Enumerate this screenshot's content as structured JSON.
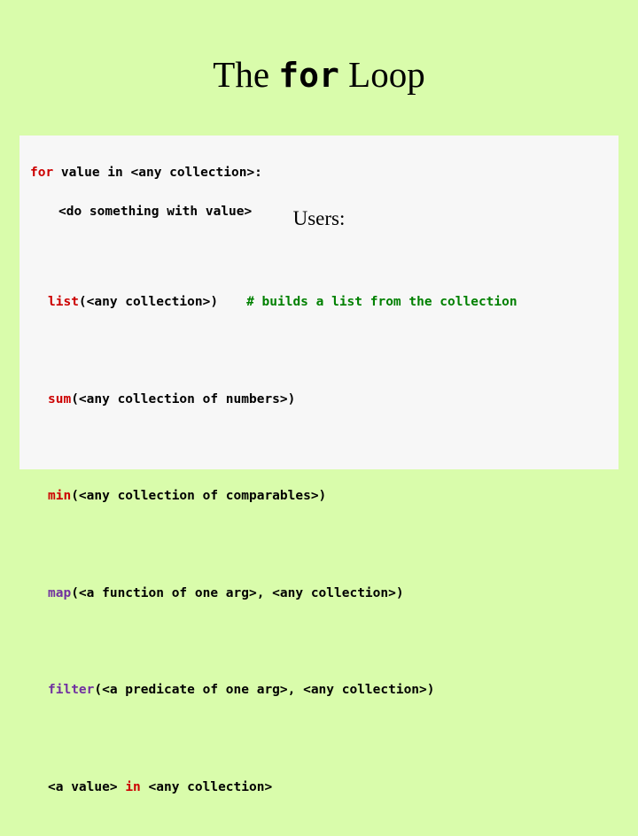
{
  "slide": {
    "background_color": "#d9fcab",
    "title": {
      "prefix": "The ",
      "keyword": "for",
      "suffix": " Loop"
    },
    "code_block": {
      "line1_kw": "for",
      "line1_rest": " value in <any collection>:",
      "line2": "<do something with value>"
    },
    "users_heading": "Users:",
    "examples": [
      {
        "func": "list",
        "args": "(<any collection>)",
        "comment": "# builds a list from the collection"
      },
      {
        "func": "sum",
        "args": "(<any collection of numbers>)",
        "comment": ""
      },
      {
        "func": "min",
        "args": "(<any collection of comparables>)",
        "comment": ""
      },
      {
        "func": "map",
        "args": "(<a function of one arg>, <any collection>)",
        "comment": ""
      },
      {
        "func": "filter",
        "args": "(<a predicate of one arg>, <any collection>)",
        "comment": ""
      }
    ],
    "membership_line": {
      "left": "<a value> ",
      "keyword": "in",
      "right": " <any collection>"
    },
    "colors": {
      "keyword_red": "#cc0000",
      "comment_green": "#008000",
      "func_purple": "#7030a0",
      "code_bg": "#f7f7f7"
    }
  }
}
